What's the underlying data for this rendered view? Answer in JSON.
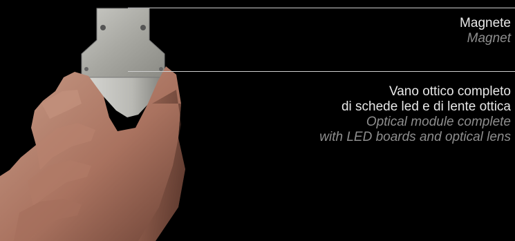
{
  "labels": {
    "magnet": {
      "it": "Magnete",
      "en": "Magnet"
    },
    "optical": {
      "it_line1": "Vano ottico completo",
      "it_line2": "di schede led e di lente ottica",
      "en_line1": "Optical module complete",
      "en_line2": "with LED boards and optical lens"
    }
  }
}
